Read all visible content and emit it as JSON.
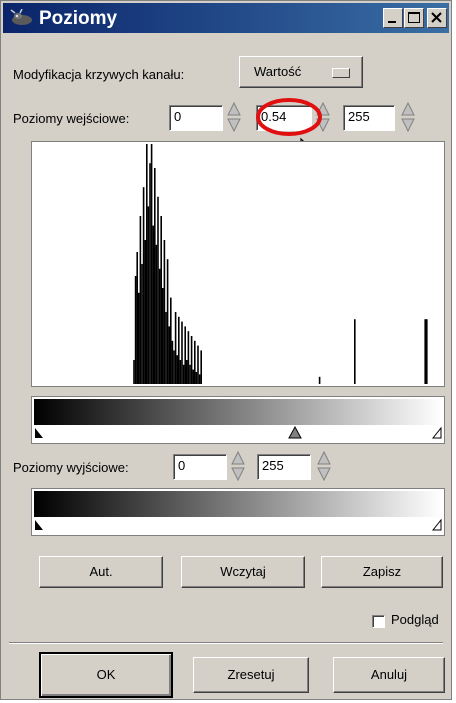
{
  "window": {
    "title": "Poziomy",
    "icon": "gimp-wilber-icon",
    "controls": [
      "minimize-icon",
      "maximize-icon",
      "close-icon"
    ]
  },
  "channel": {
    "label": "Modyfikacja krzywych kanału:",
    "selected": "Wartość"
  },
  "input_levels": {
    "label": "Poziomy wejściowe:",
    "low": "0",
    "gamma": "0.54",
    "high": "255"
  },
  "output_levels": {
    "label": "Poziomy wyjściowe:",
    "low": "0",
    "high": "255"
  },
  "buttons": {
    "auto": "Aut.",
    "load": "Wczytaj",
    "save": "Zapisz",
    "ok": "OK",
    "reset": "Zresetuj",
    "cancel": "Anuluj"
  },
  "preview": {
    "label": "Podgląd",
    "checked": false
  },
  "histogram": {
    "bars": [
      [
        62,
        0.1
      ],
      [
        63,
        0.45
      ],
      [
        64,
        0.55
      ],
      [
        65,
        0.38
      ],
      [
        66,
        0.7
      ],
      [
        67,
        0.5
      ],
      [
        68,
        0.82
      ],
      [
        69,
        0.6
      ],
      [
        70,
        1.0
      ],
      [
        71,
        0.74
      ],
      [
        72,
        0.92
      ],
      [
        73,
        1.0
      ],
      [
        74,
        0.66
      ],
      [
        75,
        0.9
      ],
      [
        76,
        0.58
      ],
      [
        77,
        0.78
      ],
      [
        78,
        0.48
      ],
      [
        79,
        0.7
      ],
      [
        80,
        0.4
      ],
      [
        81,
        0.6
      ],
      [
        82,
        0.3
      ],
      [
        83,
        0.52
      ],
      [
        84,
        0.24
      ],
      [
        85,
        0.36
      ],
      [
        86,
        0.18
      ],
      [
        87,
        0.14
      ],
      [
        88,
        0.3
      ],
      [
        89,
        0.12
      ],
      [
        90,
        0.28
      ],
      [
        91,
        0.1
      ],
      [
        92,
        0.26
      ],
      [
        93,
        0.08
      ],
      [
        94,
        0.24
      ],
      [
        95,
        0.1
      ],
      [
        96,
        0.22
      ],
      [
        97,
        0.08
      ],
      [
        98,
        0.2
      ],
      [
        99,
        0.06
      ],
      [
        100,
        0.18
      ],
      [
        101,
        0.05
      ],
      [
        102,
        0.16
      ],
      [
        103,
        0.04
      ],
      [
        104,
        0.14
      ],
      [
        178,
        0.03
      ],
      [
        200,
        0.27
      ],
      [
        244,
        0.27
      ],
      [
        245,
        0.27
      ]
    ]
  }
}
